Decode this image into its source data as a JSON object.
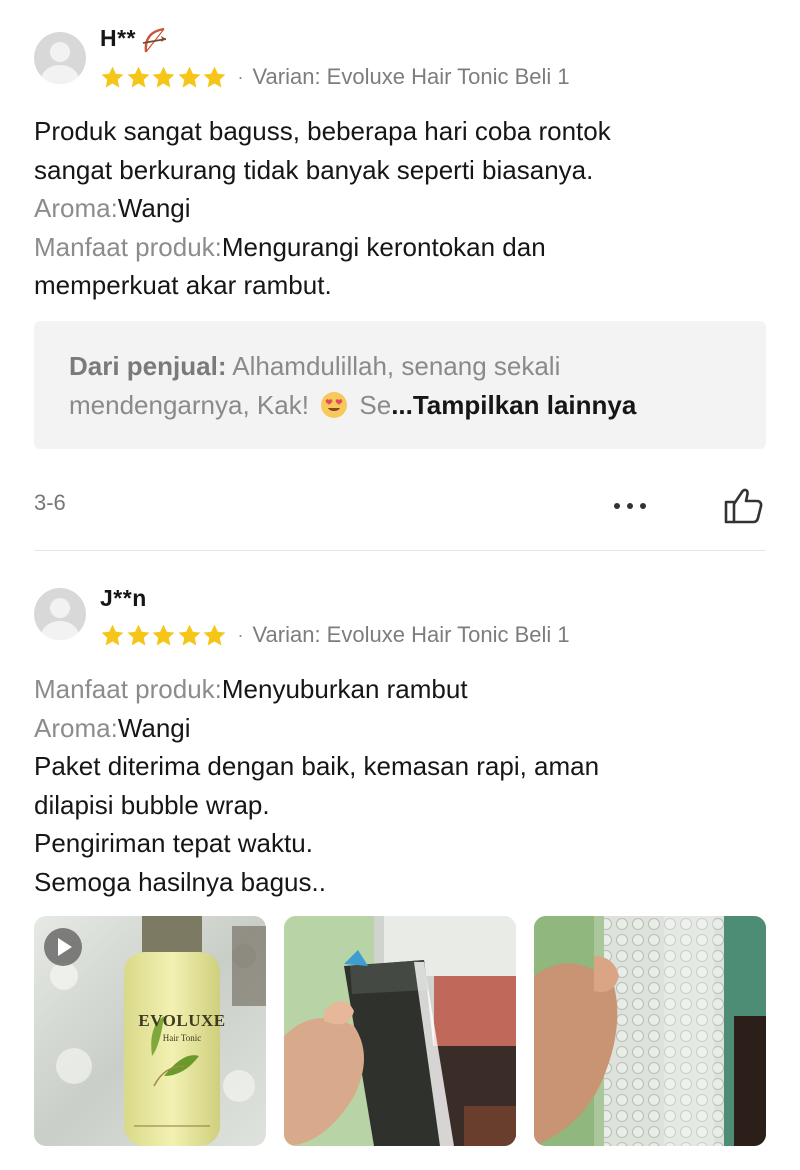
{
  "reviews": [
    {
      "username": "H**",
      "rating": 5,
      "variant": "Varian: Evoluxe Hair Tonic Beli 1",
      "body_lines": [
        "Produk sangat baguss, beberapa hari coba rontok",
        "sangat berkurang tidak banyak seperti biasanya."
      ],
      "aroma_label": "Aroma:",
      "aroma_value": "Wangi",
      "benefit_label": "Manfaat produk:",
      "benefit_value": "Mengurangi kerontokan dan",
      "benefit_value_2": "memperkuat akar rambut.",
      "seller_reply": {
        "label": "Dari penjual:",
        "text_1": " Alhamdulillah, senang sekali",
        "text_2": "mendengarnya, Kak! ",
        "text_3": " Se",
        "more": "...Tampilkan lainnya"
      },
      "date": "3-6"
    },
    {
      "username": "J**n",
      "rating": 5,
      "variant": "Varian: Evoluxe Hair Tonic Beli 1",
      "benefit_label": "Manfaat produk:",
      "benefit_value": "Menyuburkan rambut",
      "aroma_label": "Aroma:",
      "aroma_value": "Wangi",
      "body_lines": [
        "Paket diterima dengan baik, kemasan rapi, aman",
        "dilapisi bubble wrap.",
        "Pengiriman tepat waktu.",
        "Semoga hasilnya bagus.."
      ],
      "media": {
        "bottle_brand": "EVOLUXE",
        "bottle_sub": "Hair Tonic"
      }
    }
  ],
  "colors": {
    "star": "#f5c518",
    "accent_text": "#161616",
    "muted": "#8c8c8c"
  }
}
